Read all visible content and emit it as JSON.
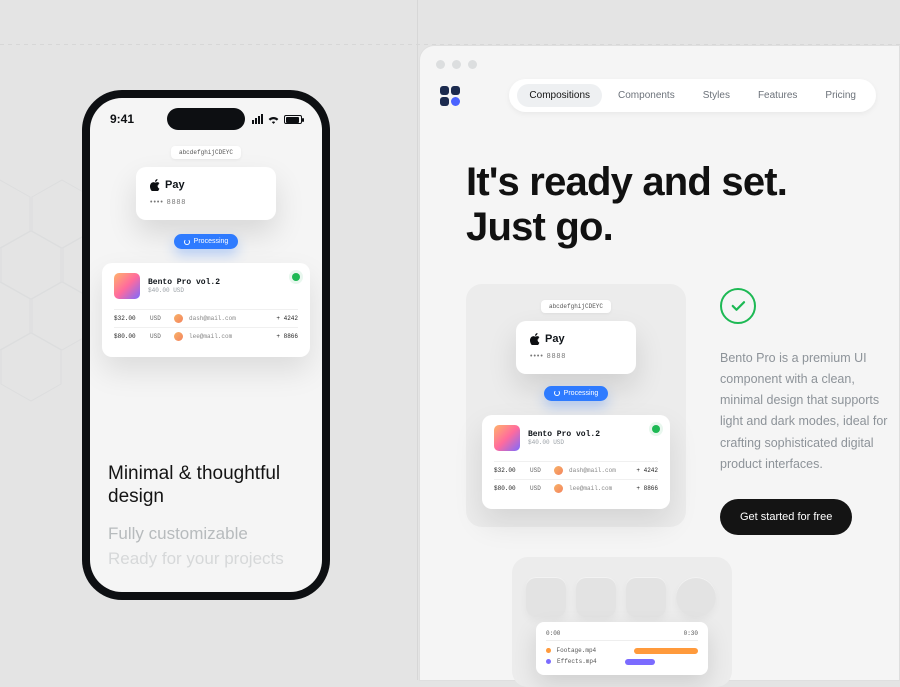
{
  "phone": {
    "statusTime": "9:41",
    "chipLabel": "abcdefghijCDEYC",
    "payTitle": "Pay",
    "payMasked": "•••• 8888",
    "processing": "Processing",
    "product": {
      "title": "Bento Pro vol.2",
      "subtitle": "$40.00 USD",
      "rows": [
        {
          "price": "$32.00",
          "currency": "USD",
          "email": "dash@mail.com",
          "id": "+ 4242"
        },
        {
          "price": "$80.00",
          "currency": "USD",
          "email": "lee@mail.com",
          "id": "+ 8866"
        }
      ]
    },
    "headline": "Minimal & thoughtful design",
    "line2": "Fully customizable",
    "line3": "Ready for your projects"
  },
  "browser": {
    "nav": {
      "items": [
        "Compositions",
        "Components",
        "Styles",
        "Features",
        "Pricing"
      ],
      "activeIndex": 0
    },
    "heroTitle1": "It's ready and set.",
    "heroTitle2": "Just go.",
    "description": "Bento Pro is a premium UI component with a clean, minimal design that supports light and dark modes, ideal for crafting sophisticated digital product interfaces.",
    "cta": "Get started for free",
    "card": {
      "chipLabel": "abcdefghijCDEYC",
      "payTitle": "Pay",
      "payMasked": "•••• 8888",
      "processing": "Processing",
      "product": {
        "title": "Bento Pro vol.2",
        "subtitle": "$40.00 USD",
        "rows": [
          {
            "price": "$32.00",
            "currency": "USD",
            "email": "dash@mail.com",
            "id": "+ 4242"
          },
          {
            "price": "$80.00",
            "currency": "USD",
            "email": "lee@mail.com",
            "id": "+ 8866"
          }
        ]
      }
    },
    "timeline": {
      "start": "0:00",
      "end": "0:30",
      "rows": [
        {
          "name": "Footage.mp4",
          "color": "#ff9a3c",
          "offset": 28,
          "width": 70
        },
        {
          "name": "Effects.mp4",
          "color": "#7b6bff",
          "offset": 14,
          "width": 30
        }
      ]
    }
  }
}
